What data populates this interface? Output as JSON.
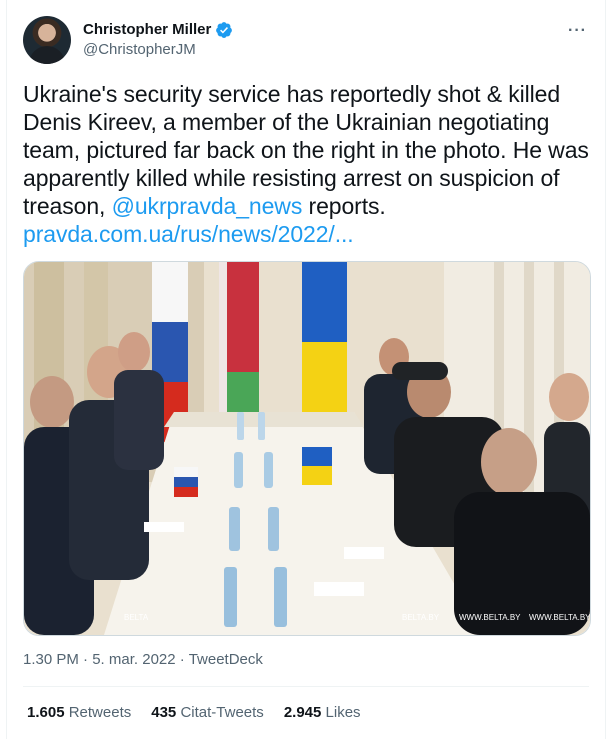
{
  "author": {
    "display_name": "Christopher Miller",
    "handle": "@ChristopherJM",
    "verified": true
  },
  "tweet": {
    "text_part1": "Ukraine's security service has reportedly shot & killed Denis Kireev, a member of the Ukrainian negotiating team, pictured far back on the right in the photo. He was apparently killed while resisting arrest on suspicion of treason, ",
    "mention": "@ukrpravda_news",
    "text_part2": " reports.",
    "link": "pravda.com.ua/rus/news/2022/..."
  },
  "photo": {
    "watermarks": [
      "BELTA",
      "BELTA.BY",
      "WWW.BELTA.BY",
      "WWW.BELTA.BY"
    ]
  },
  "meta": {
    "time": "1.30 PM",
    "separator": "·",
    "date": "5. mar. 2022",
    "source": "TweetDeck"
  },
  "stats": [
    {
      "count": "1.605",
      "label": "Retweets"
    },
    {
      "count": "435",
      "label": "Citat-Tweets"
    },
    {
      "count": "2.945",
      "label": "Likes"
    }
  ],
  "colors": {
    "accent": "#1d9bf0",
    "secondary_text": "#536471"
  },
  "icons": [
    "verified-badge-icon",
    "more-options-icon"
  ]
}
